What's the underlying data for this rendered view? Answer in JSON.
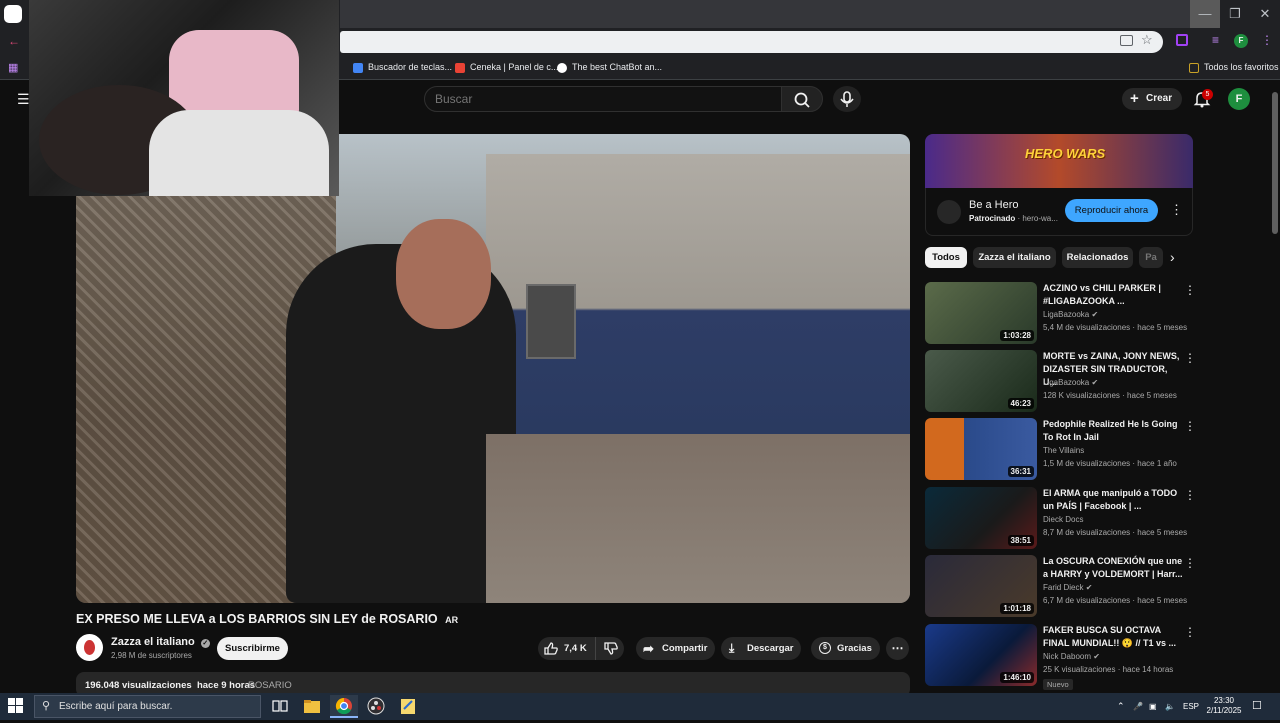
{
  "browser": {
    "bookmarks": [
      {
        "label": "Buscador de teclas...",
        "color": "#4285f4"
      },
      {
        "label": "Ceneka | Panel de c...",
        "color": "#ea4335"
      },
      {
        "label": "The best ChatBot an...",
        "color": "#ffffff"
      }
    ],
    "all_bookmarks": "Todos los favoritos",
    "profile_initial": "F"
  },
  "masthead": {
    "search_placeholder": "Buscar",
    "create_label": "Crear",
    "notifications_count": "5",
    "avatar_initial": "F"
  },
  "video": {
    "title": "EX PRESO ME LLEVA a LOS BARRIOS SIN LEY de ROSARIO",
    "title_flag": "AR",
    "channel_name": "Zazza el italiano",
    "subscribers": "2,98 M de suscriptores",
    "subscribe_label": "Suscribirme",
    "likes": "7,4 K",
    "share_label": "Compartir",
    "download_label": "Descargar",
    "thanks_label": "Gracias",
    "views": "196.048 visualizaciones",
    "age": "hace 9 horas",
    "tag": "ROSARIO"
  },
  "ad": {
    "banner_text": "HERO WARS",
    "title": "Be a Hero",
    "sponsored": "Patrocinado",
    "domain": "hero-wa...",
    "play_label": "Reproducir ahora"
  },
  "chips": [
    "Todos",
    "Zazza el italiano",
    "Relacionados",
    "Pa"
  ],
  "recommendations": [
    {
      "title": "ACZINO vs CHILI PARKER | #LIGABAZOOKA ...",
      "channel": "LigaBazooka",
      "views": "5,4 M de visualizaciones",
      "age": "hace 5 meses",
      "duration": "1:03:28",
      "thumb_color": "#4a5a3a",
      "verified": true,
      "new": ""
    },
    {
      "title": "MORTE vs ZAINA, JONY NEWS, DIZASTER SIN TRADUCTOR, U...",
      "channel": "LigaBazooka",
      "views": "128 K visualizaciones",
      "age": "hace 5 meses",
      "duration": "46:23",
      "thumb_color": "#3a4a3a",
      "verified": true,
      "new": ""
    },
    {
      "title": "Pedophile Realized He Is Going To Rot In Jail",
      "channel": "The Villains",
      "views": "1,5 M de visualizaciones",
      "age": "hace 1 año",
      "duration": "36:31",
      "thumb_color": "#2a4a7a",
      "verified": false,
      "new": ""
    },
    {
      "title": "El ARMA que manipuló a TODO un PAÍS | Facebook | ...",
      "channel": "Dieck Docs",
      "views": "8,7 M de visualizaciones",
      "age": "hace 5 meses",
      "duration": "38:51",
      "thumb_color": "#1a2a3a",
      "verified": false,
      "new": ""
    },
    {
      "title": "La OSCURA CONEXIÓN que une a HARRY y VOLDEMORT | Harr...",
      "channel": "Farid Dieck",
      "views": "6,7 M de visualizaciones",
      "age": "hace 5 meses",
      "duration": "1:01:18",
      "thumb_color": "#2a2a3a",
      "verified": true,
      "new": ""
    },
    {
      "title": "FAKER BUSCA SU OCTAVA FINAL MUNDIAL!! 😲 // T1 vs ...",
      "channel": "Nick Daboom",
      "views": "25 K visualizaciones",
      "age": "hace 14 horas",
      "duration": "1:46:10",
      "thumb_color": "#1a3a6a",
      "verified": true,
      "new": "Nuevo"
    }
  ],
  "taskbar": {
    "search_placeholder": "Escribe aquí para buscar.",
    "lang": "ESP",
    "time": "23:30",
    "date": "2/11/2025"
  }
}
